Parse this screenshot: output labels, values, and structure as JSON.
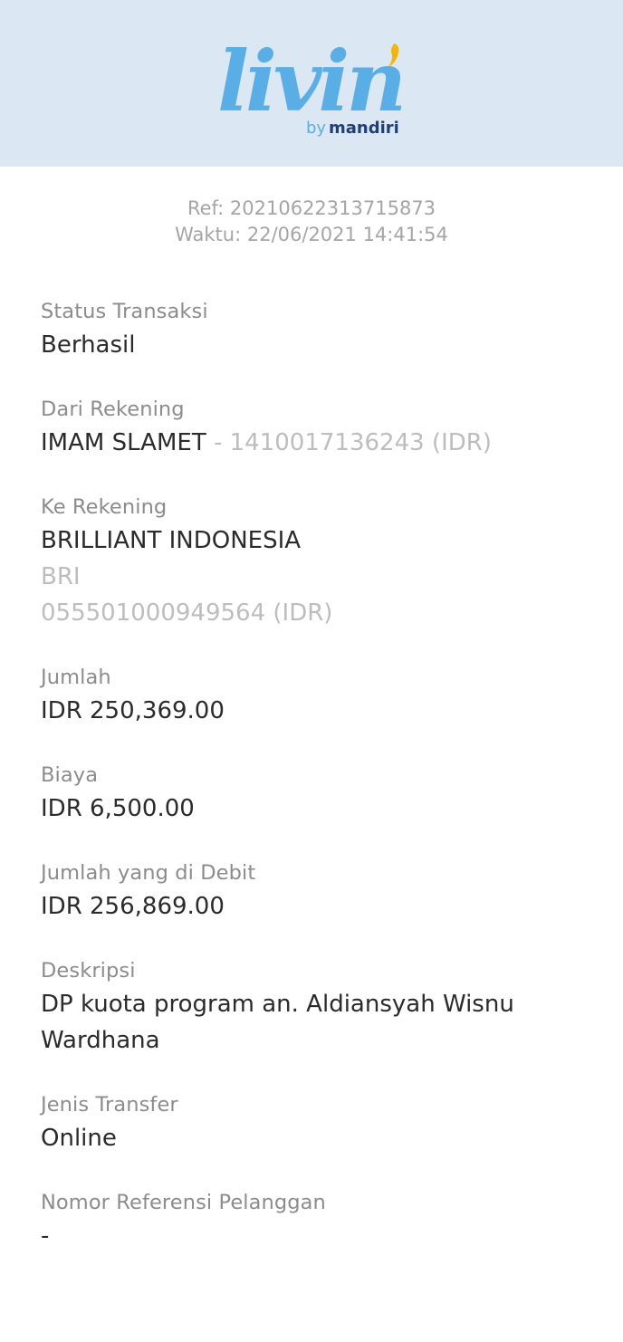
{
  "brand": {
    "logo_word": "livin'",
    "logo_sub_prefix": "by",
    "logo_sub_brand": "mandiri",
    "colors": {
      "logo_blue": "#5aaee6",
      "accent_yellow": "#f7b500",
      "mandiri_navy": "#1e3f7a",
      "header_bg": "#dbe7f3"
    }
  },
  "receipt": {
    "ref": "Ref: 20210622313715873",
    "time": "Waktu: 22/06/2021 14:41:54"
  },
  "fields": {
    "status": {
      "label": "Status Transaksi",
      "value": "Berhasil"
    },
    "from": {
      "label": "Dari Rekening",
      "name": "IMAM SLAMET",
      "account": " - 1410017136243 (IDR)"
    },
    "to": {
      "label": "Ke Rekening",
      "name": "BRILLIANT INDONESIA",
      "bank": "BRI",
      "account": "055501000949564 (IDR)"
    },
    "amount": {
      "label": "Jumlah",
      "value": "IDR 250,369.00"
    },
    "fee": {
      "label": "Biaya",
      "value": "IDR 6,500.00"
    },
    "debited": {
      "label": "Jumlah yang di Debit",
      "value": "IDR 256,869.00"
    },
    "description": {
      "label": "Deskripsi",
      "value": "DP kuota program an. Aldiansyah Wisnu Wardhana"
    },
    "transfer_type": {
      "label": "Jenis Transfer",
      "value": "Online"
    },
    "customer_ref": {
      "label": "Nomor Referensi Pelanggan",
      "value": "-"
    }
  }
}
